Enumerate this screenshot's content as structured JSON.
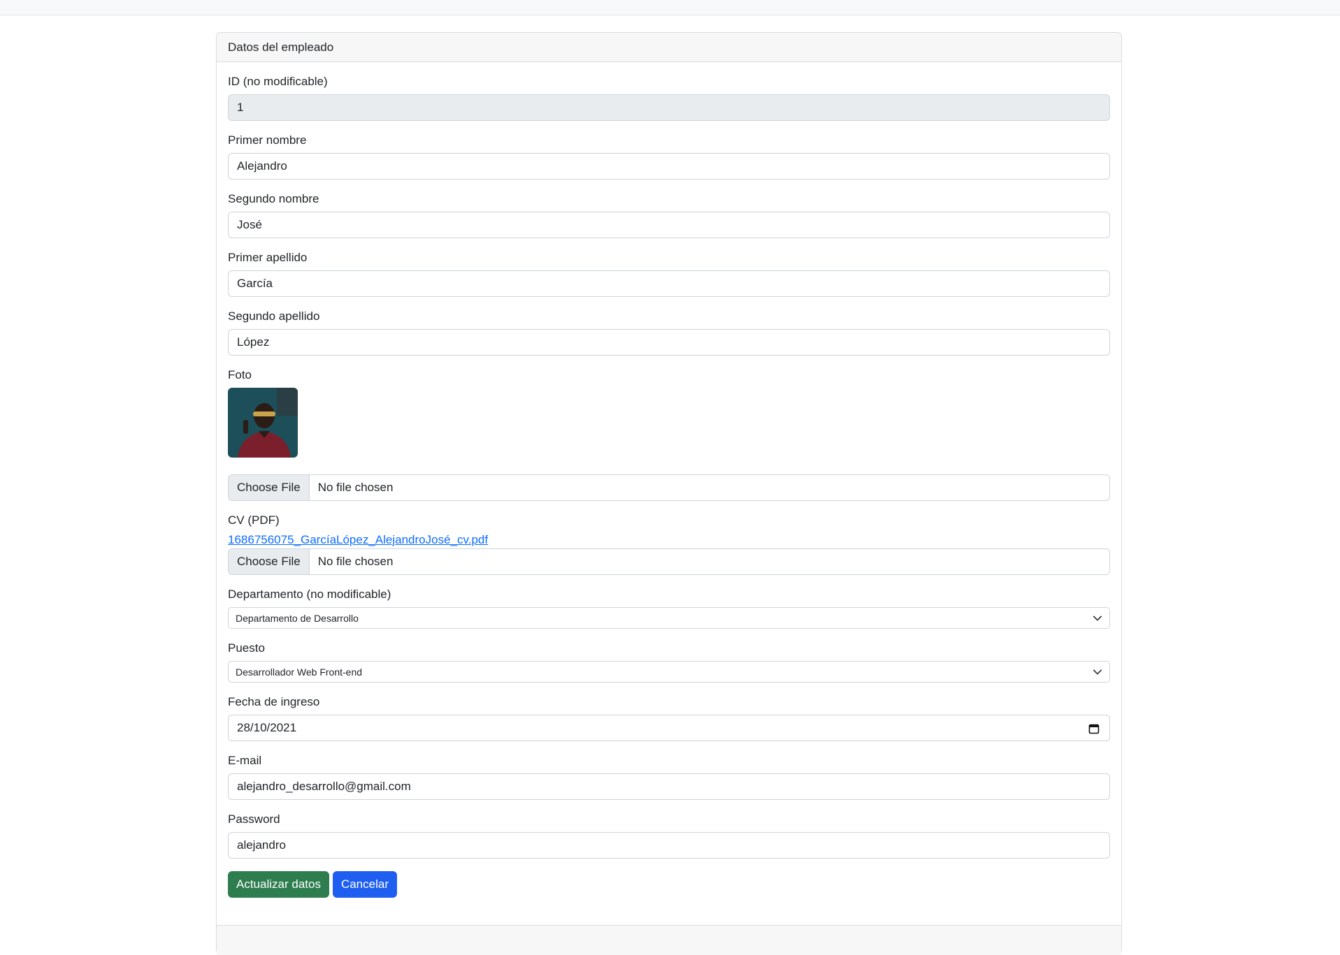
{
  "card": {
    "header": "Datos del empleado"
  },
  "fields": {
    "id": {
      "label": "ID (no modificable)",
      "value": "1"
    },
    "primer_nombre": {
      "label": "Primer nombre",
      "value": "Alejandro"
    },
    "segundo_nombre": {
      "label": "Segundo nombre",
      "value": "José"
    },
    "primer_apellido": {
      "label": "Primer apellido",
      "value": "García"
    },
    "segundo_apellido": {
      "label": "Segundo apellido",
      "value": "López"
    },
    "foto": {
      "label": "Foto",
      "button": "Choose File",
      "status": "No file chosen"
    },
    "cv": {
      "label": "CV (PDF)",
      "link": "1686756075_GarcíaLópez_AlejandroJosé_cv.pdf",
      "button": "Choose File",
      "status": "No file chosen"
    },
    "departamento": {
      "label": "Departamento (no modificable)",
      "value": "Departamento de Desarrollo"
    },
    "puesto": {
      "label": "Puesto",
      "value": "Desarrollador Web Front-end"
    },
    "fecha_ingreso": {
      "label": "Fecha de ingreso",
      "value": "28/10/2021"
    },
    "email": {
      "label": "E-mail",
      "value": "alejandro_desarrollo@gmail.com"
    },
    "password": {
      "label": "Password",
      "value": "alejandro"
    }
  },
  "actions": {
    "update": "Actualizar datos",
    "cancel": "Cancelar"
  },
  "colors": {
    "success": "#2e7d4f",
    "primary": "#1e5ef0",
    "link": "#0d6efd"
  },
  "icons": {
    "select": "chevron-down-icon",
    "date": "calendar-icon"
  }
}
